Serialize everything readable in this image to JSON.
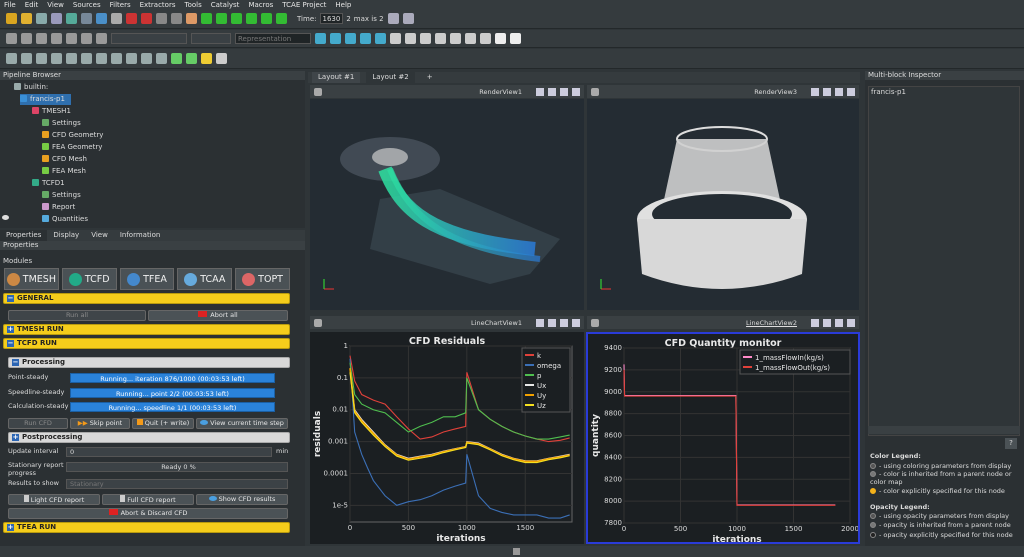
{
  "menu": [
    "File",
    "Edit",
    "View",
    "Sources",
    "Filters",
    "Extractors",
    "Tools",
    "Catalyst",
    "Macros",
    "TCAE Project",
    "Help"
  ],
  "toolbar": {
    "time_label": "Time:",
    "time_value": "1630",
    "time_index": "2",
    "max_label": "max is 2",
    "representation": "Representation"
  },
  "pipeline": {
    "title": "Pipeline Browser",
    "items": [
      {
        "label": "builtin:",
        "icon": "server-icon",
        "color": "#9aa"
      },
      {
        "label": "francis-p1",
        "icon": "folder-icon",
        "color": "#3a90d8"
      },
      {
        "label": "TMESH1",
        "icon": "module-icon",
        "color": "#d46"
      },
      {
        "label": "Settings",
        "icon": "settings-icon",
        "color": "#6a6"
      },
      {
        "label": "CFD Geometry",
        "icon": "geometry-icon",
        "color": "#e9a020"
      },
      {
        "label": "FEA Geometry",
        "icon": "geometry-icon",
        "color": "#7c4"
      },
      {
        "label": "CFD Mesh",
        "icon": "mesh-icon",
        "color": "#e9a020"
      },
      {
        "label": "FEA Mesh",
        "icon": "mesh-icon",
        "color": "#7c4"
      },
      {
        "label": "TCFD1",
        "icon": "module-icon",
        "color": "#3a8"
      },
      {
        "label": "Settings",
        "icon": "settings-icon",
        "color": "#6a6"
      },
      {
        "label": "Report",
        "icon": "report-icon",
        "color": "#c9c"
      },
      {
        "label": "Quantities",
        "icon": "quantities-icon",
        "color": "#5ad"
      }
    ]
  },
  "properties": {
    "tabs": [
      "Properties",
      "Display",
      "View",
      "Information"
    ],
    "title": "Properties",
    "modules_label": "Modules",
    "modules": [
      {
        "label": "TMESH",
        "color": "#c84"
      },
      {
        "label": "TCFD",
        "color": "#2a8"
      },
      {
        "label": "TFEA",
        "color": "#48c"
      },
      {
        "label": "TCAA",
        "color": "#6ad"
      },
      {
        "label": "TOPT",
        "color": "#d66"
      }
    ],
    "general": "GENERAL",
    "run_all": "Run all",
    "abort_all": "Abort all",
    "tmesh_run": "TMESH RUN",
    "tcfd_run": "TCFD RUN",
    "processing": "Processing",
    "rows": [
      {
        "label": "Point-steady",
        "value": "Running... iteration 876/1000 (00:03:53 left)"
      },
      {
        "label": "Speedline-steady",
        "value": "Running... point 2/2 (00:03:53 left)"
      },
      {
        "label": "Calculation-steady",
        "value": "Running... speedline 1/1 (00:03:53 left)"
      }
    ],
    "run_cfd": "Run CFD",
    "skip_point": "Skip point",
    "quit_write": "Quit (+ write)",
    "view_time_step": "View current time step",
    "postprocessing": "Postprocessing",
    "update_interval_label": "Update interval",
    "update_interval_value": "0",
    "update_interval_unit": "min",
    "stationary_label": "Stationary report progress",
    "stationary_value": "Ready 0 %",
    "results_label": "Results to show",
    "results_value": "Stationary",
    "light_report": "Light CFD report",
    "full_report": "Full CFD report",
    "show_results": "Show CFD results",
    "abort_discard": "Abort & Discard CFD",
    "tfea_run": "TFEA RUN"
  },
  "layout": {
    "tabs": [
      "Layout #1",
      "Layout #2",
      "+"
    ],
    "views": [
      "RenderView1",
      "RenderView3",
      "LineChartView1",
      "LineChartView2"
    ]
  },
  "inspector": {
    "title": "Multi-block Inspector",
    "item": "francis-p1",
    "color_legend_title": "Color Legend:",
    "color_legend": [
      "- using coloring parameters from display",
      "- color is inherited from a parent node or color map",
      "- color explicitly specified for this node"
    ],
    "opacity_legend_title": "Opacity Legend:",
    "opacity_legend": [
      "- using opacity parameters from display",
      "- opacity is inherited from a parent node",
      "- opacity explicitly specified for this node"
    ]
  },
  "chart_data": [
    {
      "type": "line",
      "title": "CFD Residuals",
      "xlabel": "iterations",
      "ylabel": "residuals",
      "yscale": "log",
      "xlim": [
        0,
        1900
      ],
      "ylim": [
        3e-06,
        1
      ],
      "x_ticks": [
        "0",
        "500",
        "1000",
        "1500"
      ],
      "y_ticks": [
        "1",
        "0.1",
        "0.01",
        "0.001",
        "0.0001",
        "1e-5"
      ],
      "legend": "top-right",
      "grid": true,
      "series": [
        {
          "name": "k",
          "color": "#e0413a",
          "x": [
            0,
            40,
            100,
            200,
            300,
            400,
            500,
            600,
            700,
            800,
            900,
            990,
            1000,
            1100,
            1200,
            1300,
            1400,
            1500,
            1600,
            1700,
            1800,
            1880
          ],
          "y": [
            0.5,
            0.08,
            0.03,
            0.02,
            0.015,
            0.006,
            0.0025,
            0.0012,
            0.0014,
            0.002,
            0.0025,
            0.003,
            0.15,
            0.01,
            0.005,
            0.003,
            0.002,
            0.0015,
            0.0012,
            0.001,
            0.0011,
            0.0013
          ]
        },
        {
          "name": "omega",
          "color": "#3b6fb6",
          "x": [
            0,
            40,
            100,
            150,
            200,
            300,
            400,
            500,
            600,
            700,
            800,
            900,
            990,
            1000,
            1100,
            1200,
            1300,
            1400,
            1500,
            1600,
            1700,
            1800,
            1880
          ],
          "y": [
            0.4,
            0.002,
            0.0004,
            0.00015,
            6e-05,
            2e-05,
            1e-05,
            1.3e-05,
            1.5e-05,
            2e-05,
            3e-05,
            4e-05,
            5e-05,
            0.0004,
            2e-05,
            8e-06,
            6e-06,
            5e-06,
            5e-06,
            5e-06,
            4e-06,
            4e-06,
            5e-06
          ]
        },
        {
          "name": "p",
          "color": "#4fbf4f",
          "x": [
            0,
            40,
            100,
            200,
            300,
            400,
            500,
            600,
            700,
            800,
            900,
            990,
            1000,
            1100,
            1200,
            1300,
            1400,
            1500,
            1600,
            1700,
            1800,
            1880
          ],
          "y": [
            0.3,
            0.03,
            0.015,
            0.01,
            0.008,
            0.004,
            0.002,
            0.003,
            0.004,
            0.006,
            0.006,
            0.008,
            0.1,
            0.01,
            0.005,
            0.003,
            0.002,
            0.0015,
            0.0012,
            0.0012,
            0.0014,
            0.0016
          ]
        },
        {
          "name": "Ux",
          "color": "#e8e8e8",
          "x": [
            0,
            40,
            100,
            200,
            300,
            400,
            500,
            600,
            700,
            800,
            900,
            990,
            1000,
            1100,
            1200,
            1300,
            1400,
            1500,
            1600,
            1700,
            1800,
            1880
          ],
          "y": [
            0.2,
            0.01,
            0.005,
            0.002,
            0.0008,
            0.0004,
            0.0003,
            0.00035,
            0.0004,
            0.0005,
            0.0006,
            0.0007,
            0.001,
            0.0009,
            0.0006,
            0.0004,
            0.0003,
            0.00025,
            0.00025,
            0.0003,
            0.00035,
            0.0004
          ]
        },
        {
          "name": "Uy",
          "color": "#f2a100",
          "x": [
            0,
            40,
            100,
            200,
            300,
            400,
            500,
            600,
            700,
            800,
            900,
            990,
            1000,
            1100,
            1200,
            1300,
            1400,
            1500,
            1600,
            1700,
            1800,
            1880
          ],
          "y": [
            0.2,
            0.009,
            0.0045,
            0.0018,
            0.00075,
            0.00038,
            0.00028,
            0.00033,
            0.00038,
            0.00048,
            0.00058,
            0.00068,
            0.00095,
            0.00085,
            0.00058,
            0.00038,
            0.00029,
            0.00024,
            0.00024,
            0.00029,
            0.00033,
            0.00038
          ]
        },
        {
          "name": "Uz",
          "color": "#f5e020",
          "x": [
            0,
            40,
            100,
            200,
            300,
            400,
            500,
            600,
            700,
            800,
            900,
            990,
            1000,
            1100,
            1200,
            1300,
            1400,
            1500,
            1600,
            1700,
            1800,
            1880
          ],
          "y": [
            0.15,
            0.008,
            0.004,
            0.0016,
            0.0007,
            0.00035,
            0.00026,
            0.0003,
            0.00035,
            0.00045,
            0.00055,
            0.00065,
            0.0009,
            0.0008,
            0.00055,
            0.00036,
            0.00027,
            0.00022,
            0.00022,
            0.00027,
            0.00031,
            0.00036
          ]
        }
      ]
    },
    {
      "type": "line",
      "title": "CFD Quantity monitor",
      "xlabel": "iterations",
      "ylabel": "quantity",
      "xlim": [
        0,
        2000
      ],
      "ylim": [
        7800,
        9400
      ],
      "x_ticks": [
        "0",
        "500",
        "1000",
        "1500",
        "2000"
      ],
      "y_ticks": [
        "9400",
        "9200",
        "9000",
        "8800",
        "8600",
        "8400",
        "8200",
        "8000",
        "7800"
      ],
      "legend": "top-right",
      "grid": true,
      "series": [
        {
          "name": "1_massFlowIn(kg/s)",
          "color": "#ff8ac8",
          "x": [
            0,
            5,
            990,
            1000,
            1870
          ],
          "y": [
            9250,
            8965,
            8965,
            7965,
            7965
          ]
        },
        {
          "name": "1_massFlowOut(kg/s)",
          "color": "#e0413a",
          "x": [
            0,
            5,
            990,
            1000,
            1870
          ],
          "y": [
            9200,
            8960,
            8960,
            7962,
            7962
          ]
        }
      ]
    }
  ]
}
